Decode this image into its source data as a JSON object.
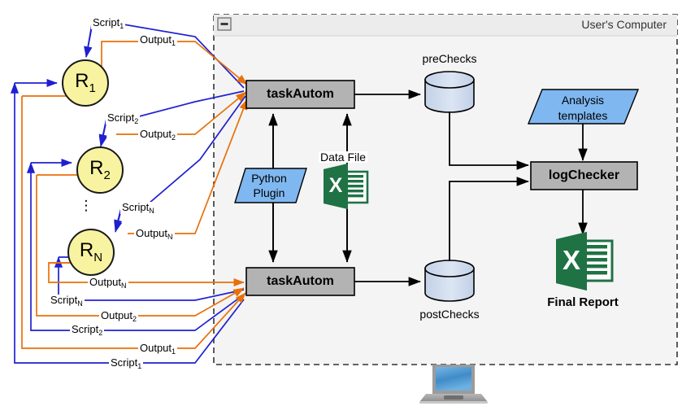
{
  "diagram": {
    "title": "taskAutom / logChecker workflow",
    "container": {
      "header_label": "User's Computer",
      "collapse_icon": "minus-icon"
    },
    "colors": {
      "script_line": "#2020d0",
      "output_line": "#e8700a",
      "flow_line": "#000000",
      "router_fill": "#f8f3a0",
      "process_fill": "#b3b3b3",
      "data_fill": "#7fb7f0",
      "cylinder_fill": "#ccd9ee",
      "excel_green": "#1f7244",
      "container_fill": "#f4f4f4",
      "header_fill": "#ececec"
    },
    "routers": [
      {
        "name": "R1",
        "base": "R",
        "sub": "1"
      },
      {
        "name": "R2",
        "base": "R",
        "sub": "2"
      },
      {
        "name": "RN",
        "base": "R",
        "sub": "N"
      }
    ],
    "ellipsis": "⋮",
    "top_labels": [
      {
        "id": "script1-top",
        "base": "Script",
        "sub": "1"
      },
      {
        "id": "output1-top",
        "base": "Output",
        "sub": "1"
      },
      {
        "id": "script2-top",
        "base": "Script",
        "sub": "2"
      },
      {
        "id": "output2-top",
        "base": "Output",
        "sub": "2"
      },
      {
        "id": "scriptN-top",
        "base": "Script",
        "sub": "N"
      },
      {
        "id": "outputN-top",
        "base": "Output",
        "sub": "N"
      }
    ],
    "bottom_labels": [
      {
        "id": "outputN-bottom",
        "base": "Output",
        "sub": "N"
      },
      {
        "id": "scriptN-bottom",
        "base": "Script",
        "sub": "N"
      },
      {
        "id": "output2-bottom",
        "base": "Output",
        "sub": "2"
      },
      {
        "id": "script2-bottom",
        "base": "Script",
        "sub": "2"
      },
      {
        "id": "output1-bottom",
        "base": "Output",
        "sub": "1"
      },
      {
        "id": "script1-bottom",
        "base": "Script",
        "sub": "1"
      }
    ],
    "nodes": {
      "task_autom_top": "taskAutom",
      "task_autom_bottom": "taskAutom",
      "python_plugin_line1": "Python",
      "python_plugin_line2": "Plugin",
      "data_file": "Data File",
      "pre_checks": "preChecks",
      "post_checks": "postChecks",
      "analysis_templates_line1": "Analysis",
      "analysis_templates_line2": "templates",
      "log_checker": "logChecker",
      "final_report": "Final Report",
      "excel_glyph": "X",
      "laptop_icon": "laptop-icon"
    }
  }
}
